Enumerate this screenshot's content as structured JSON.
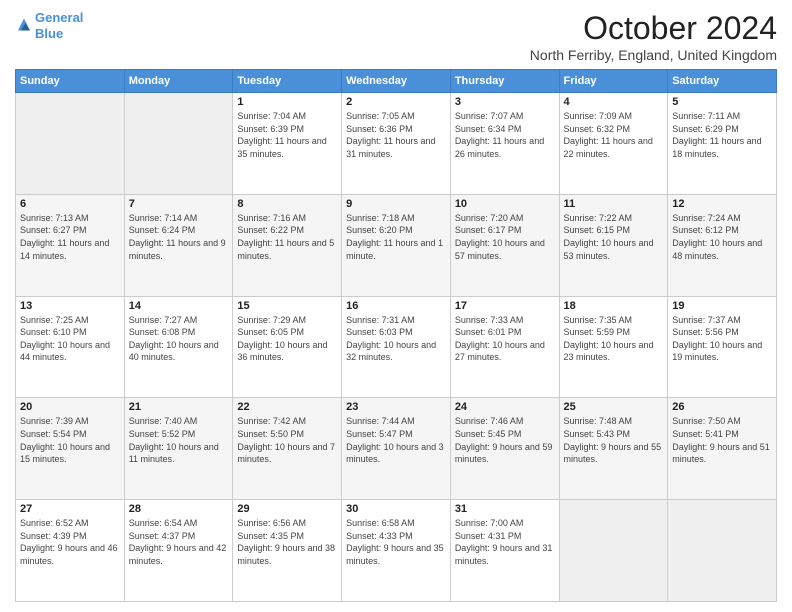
{
  "header": {
    "logo_line1": "General",
    "logo_line2": "Blue",
    "title": "October 2024",
    "subtitle": "North Ferriby, England, United Kingdom"
  },
  "days_of_week": [
    "Sunday",
    "Monday",
    "Tuesday",
    "Wednesday",
    "Thursday",
    "Friday",
    "Saturday"
  ],
  "weeks": [
    [
      {
        "day": "",
        "empty": true
      },
      {
        "day": "",
        "empty": true
      },
      {
        "day": "1",
        "sunrise": "Sunrise: 7:04 AM",
        "sunset": "Sunset: 6:39 PM",
        "daylight": "Daylight: 11 hours and 35 minutes."
      },
      {
        "day": "2",
        "sunrise": "Sunrise: 7:05 AM",
        "sunset": "Sunset: 6:36 PM",
        "daylight": "Daylight: 11 hours and 31 minutes."
      },
      {
        "day": "3",
        "sunrise": "Sunrise: 7:07 AM",
        "sunset": "Sunset: 6:34 PM",
        "daylight": "Daylight: 11 hours and 26 minutes."
      },
      {
        "day": "4",
        "sunrise": "Sunrise: 7:09 AM",
        "sunset": "Sunset: 6:32 PM",
        "daylight": "Daylight: 11 hours and 22 minutes."
      },
      {
        "day": "5",
        "sunrise": "Sunrise: 7:11 AM",
        "sunset": "Sunset: 6:29 PM",
        "daylight": "Daylight: 11 hours and 18 minutes."
      }
    ],
    [
      {
        "day": "6",
        "sunrise": "Sunrise: 7:13 AM",
        "sunset": "Sunset: 6:27 PM",
        "daylight": "Daylight: 11 hours and 14 minutes."
      },
      {
        "day": "7",
        "sunrise": "Sunrise: 7:14 AM",
        "sunset": "Sunset: 6:24 PM",
        "daylight": "Daylight: 11 hours and 9 minutes."
      },
      {
        "day": "8",
        "sunrise": "Sunrise: 7:16 AM",
        "sunset": "Sunset: 6:22 PM",
        "daylight": "Daylight: 11 hours and 5 minutes."
      },
      {
        "day": "9",
        "sunrise": "Sunrise: 7:18 AM",
        "sunset": "Sunset: 6:20 PM",
        "daylight": "Daylight: 11 hours and 1 minute."
      },
      {
        "day": "10",
        "sunrise": "Sunrise: 7:20 AM",
        "sunset": "Sunset: 6:17 PM",
        "daylight": "Daylight: 10 hours and 57 minutes."
      },
      {
        "day": "11",
        "sunrise": "Sunrise: 7:22 AM",
        "sunset": "Sunset: 6:15 PM",
        "daylight": "Daylight: 10 hours and 53 minutes."
      },
      {
        "day": "12",
        "sunrise": "Sunrise: 7:24 AM",
        "sunset": "Sunset: 6:12 PM",
        "daylight": "Daylight: 10 hours and 48 minutes."
      }
    ],
    [
      {
        "day": "13",
        "sunrise": "Sunrise: 7:25 AM",
        "sunset": "Sunset: 6:10 PM",
        "daylight": "Daylight: 10 hours and 44 minutes."
      },
      {
        "day": "14",
        "sunrise": "Sunrise: 7:27 AM",
        "sunset": "Sunset: 6:08 PM",
        "daylight": "Daylight: 10 hours and 40 minutes."
      },
      {
        "day": "15",
        "sunrise": "Sunrise: 7:29 AM",
        "sunset": "Sunset: 6:05 PM",
        "daylight": "Daylight: 10 hours and 36 minutes."
      },
      {
        "day": "16",
        "sunrise": "Sunrise: 7:31 AM",
        "sunset": "Sunset: 6:03 PM",
        "daylight": "Daylight: 10 hours and 32 minutes."
      },
      {
        "day": "17",
        "sunrise": "Sunrise: 7:33 AM",
        "sunset": "Sunset: 6:01 PM",
        "daylight": "Daylight: 10 hours and 27 minutes."
      },
      {
        "day": "18",
        "sunrise": "Sunrise: 7:35 AM",
        "sunset": "Sunset: 5:59 PM",
        "daylight": "Daylight: 10 hours and 23 minutes."
      },
      {
        "day": "19",
        "sunrise": "Sunrise: 7:37 AM",
        "sunset": "Sunset: 5:56 PM",
        "daylight": "Daylight: 10 hours and 19 minutes."
      }
    ],
    [
      {
        "day": "20",
        "sunrise": "Sunrise: 7:39 AM",
        "sunset": "Sunset: 5:54 PM",
        "daylight": "Daylight: 10 hours and 15 minutes."
      },
      {
        "day": "21",
        "sunrise": "Sunrise: 7:40 AM",
        "sunset": "Sunset: 5:52 PM",
        "daylight": "Daylight: 10 hours and 11 minutes."
      },
      {
        "day": "22",
        "sunrise": "Sunrise: 7:42 AM",
        "sunset": "Sunset: 5:50 PM",
        "daylight": "Daylight: 10 hours and 7 minutes."
      },
      {
        "day": "23",
        "sunrise": "Sunrise: 7:44 AM",
        "sunset": "Sunset: 5:47 PM",
        "daylight": "Daylight: 10 hours and 3 minutes."
      },
      {
        "day": "24",
        "sunrise": "Sunrise: 7:46 AM",
        "sunset": "Sunset: 5:45 PM",
        "daylight": "Daylight: 9 hours and 59 minutes."
      },
      {
        "day": "25",
        "sunrise": "Sunrise: 7:48 AM",
        "sunset": "Sunset: 5:43 PM",
        "daylight": "Daylight: 9 hours and 55 minutes."
      },
      {
        "day": "26",
        "sunrise": "Sunrise: 7:50 AM",
        "sunset": "Sunset: 5:41 PM",
        "daylight": "Daylight: 9 hours and 51 minutes."
      }
    ],
    [
      {
        "day": "27",
        "sunrise": "Sunrise: 6:52 AM",
        "sunset": "Sunset: 4:39 PM",
        "daylight": "Daylight: 9 hours and 46 minutes."
      },
      {
        "day": "28",
        "sunrise": "Sunrise: 6:54 AM",
        "sunset": "Sunset: 4:37 PM",
        "daylight": "Daylight: 9 hours and 42 minutes."
      },
      {
        "day": "29",
        "sunrise": "Sunrise: 6:56 AM",
        "sunset": "Sunset: 4:35 PM",
        "daylight": "Daylight: 9 hours and 38 minutes."
      },
      {
        "day": "30",
        "sunrise": "Sunrise: 6:58 AM",
        "sunset": "Sunset: 4:33 PM",
        "daylight": "Daylight: 9 hours and 35 minutes."
      },
      {
        "day": "31",
        "sunrise": "Sunrise: 7:00 AM",
        "sunset": "Sunset: 4:31 PM",
        "daylight": "Daylight: 9 hours and 31 minutes."
      },
      {
        "day": "",
        "empty": true
      },
      {
        "day": "",
        "empty": true
      }
    ]
  ]
}
